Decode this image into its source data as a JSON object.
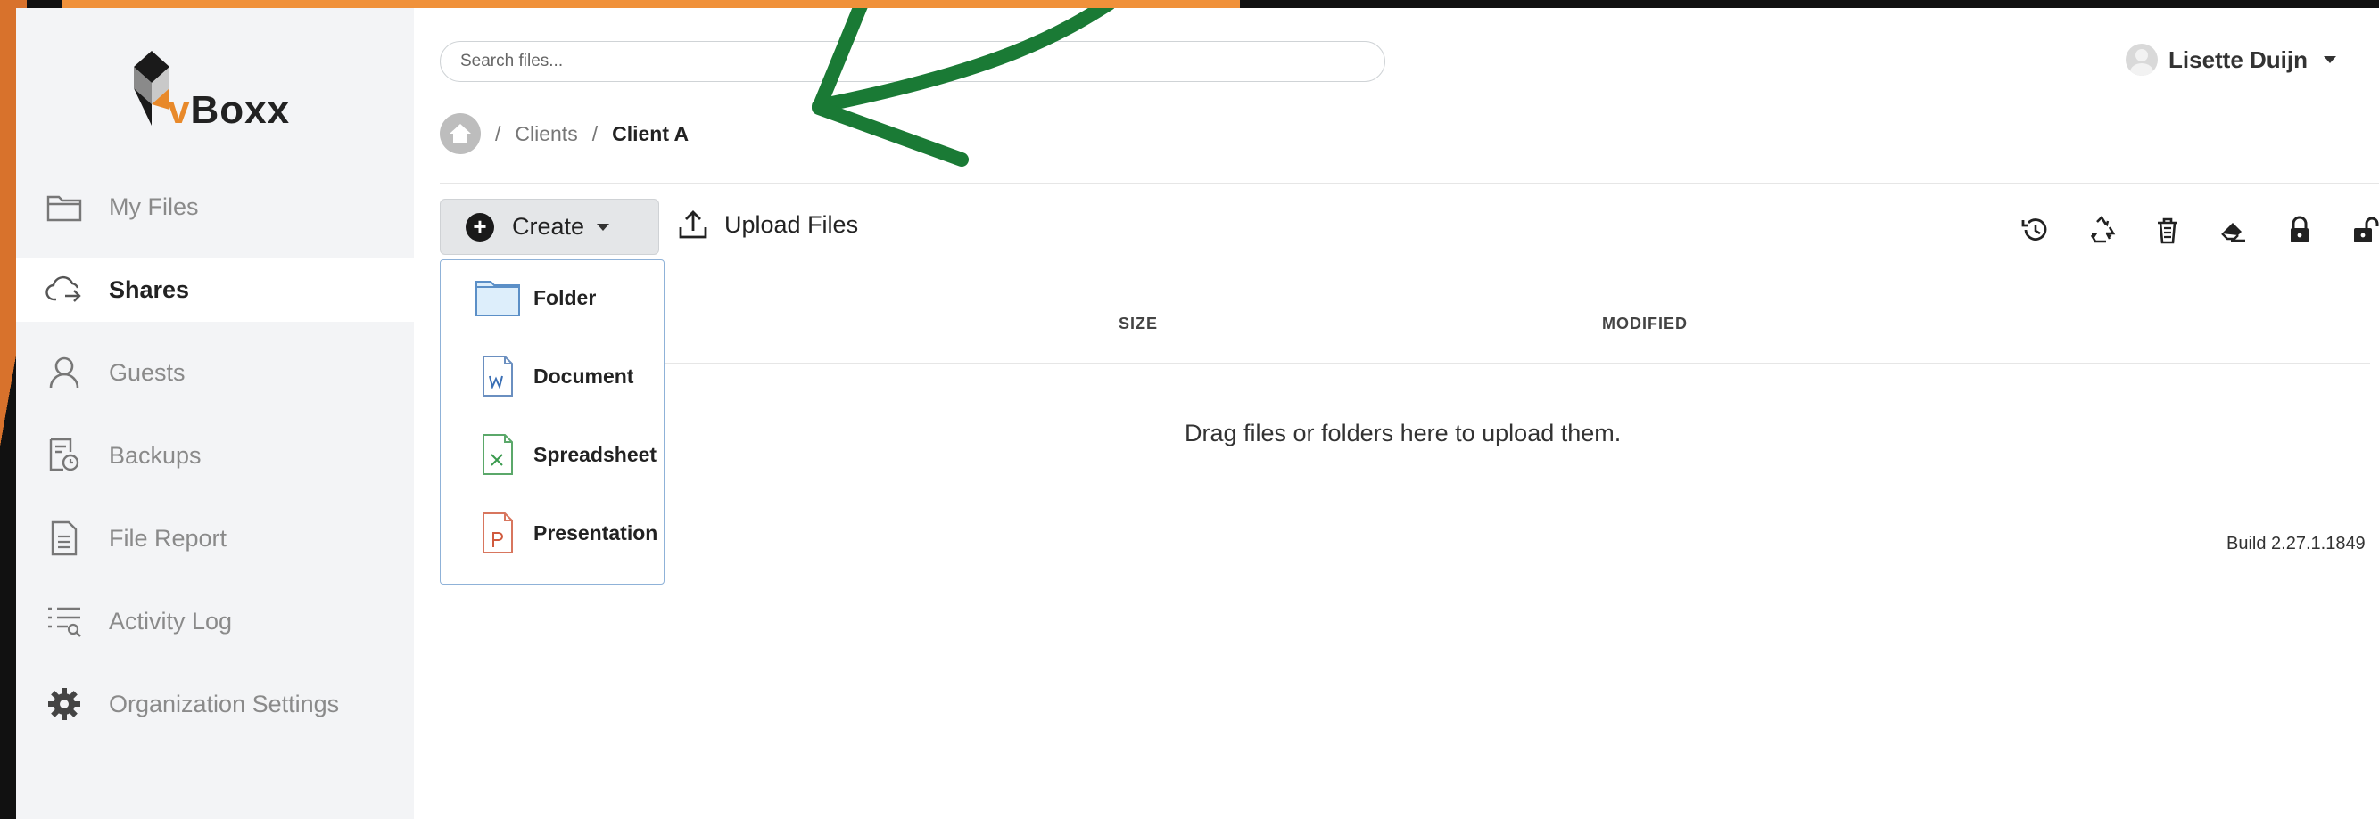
{
  "app": {
    "logo": "vBoxx",
    "logo_accent": "v",
    "logo_rest": "Boxx"
  },
  "search": {
    "placeholder": "Search files..."
  },
  "user": {
    "name": "Lisette Duijn"
  },
  "breadcrumb": {
    "separator": "/",
    "items": [
      "Clients",
      "Client A"
    ]
  },
  "sidebar": {
    "items": [
      {
        "label": "My Files",
        "icon": "folder-icon",
        "active": false
      },
      {
        "label": "Shares",
        "icon": "cloud-share-icon",
        "active": true
      },
      {
        "label": "Guests",
        "icon": "user-icon",
        "active": false
      },
      {
        "label": "Backups",
        "icon": "backup-icon",
        "active": false
      },
      {
        "label": "File Report",
        "icon": "report-icon",
        "active": false
      },
      {
        "label": "Activity Log",
        "icon": "activity-log-icon",
        "active": false
      },
      {
        "label": "Organization Settings",
        "icon": "gear-icon",
        "active": false
      }
    ]
  },
  "toolbar": {
    "create_label": "Create",
    "upload_label": "Upload Files",
    "tools": [
      "history-icon",
      "recycle-icon",
      "trash-icon",
      "eraser-icon",
      "lock-icon",
      "unlock-icon"
    ]
  },
  "create_menu": {
    "items": [
      {
        "label": "Folder",
        "icon": "folder-icon"
      },
      {
        "label": "Document",
        "icon": "word-document-icon"
      },
      {
        "label": "Spreadsheet",
        "icon": "spreadsheet-icon"
      },
      {
        "label": "Presentation",
        "icon": "presentation-icon"
      }
    ]
  },
  "table": {
    "columns": [
      "SIZE",
      "MODIFIED"
    ]
  },
  "main": {
    "empty_message": "Drag files or folders here to upload them.",
    "build": "Build 2.27.1.1849"
  },
  "colors": {
    "accent_orange": "#e8892a",
    "arrow_green": "#1a7a35",
    "sidebar_bg": "#f3f4f6"
  }
}
